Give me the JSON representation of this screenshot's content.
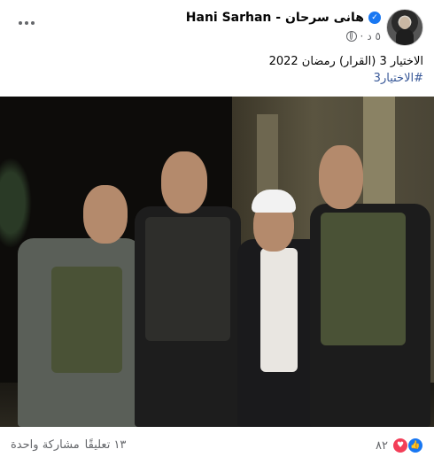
{
  "header": {
    "name": "Hani Sarhan - هانى سرحان",
    "verified_icon": "check",
    "timestamp": "٥ د",
    "privacy_icon": "globe-icon",
    "more_icon": "more-options-icon"
  },
  "caption": {
    "text": "الاختيار 3 (القرار) رمضان 2022",
    "hashtag": "#الاختيار3"
  },
  "photo": {
    "description_icon": "group-photo"
  },
  "footer": {
    "reactions_count": "٨٢",
    "comments": "١٣ تعليقًا",
    "shares": "مشاركة واحدة"
  },
  "colors": {
    "link": "#385898",
    "like": "#1877f2",
    "love": "#f33e58",
    "muted": "#65676b"
  }
}
